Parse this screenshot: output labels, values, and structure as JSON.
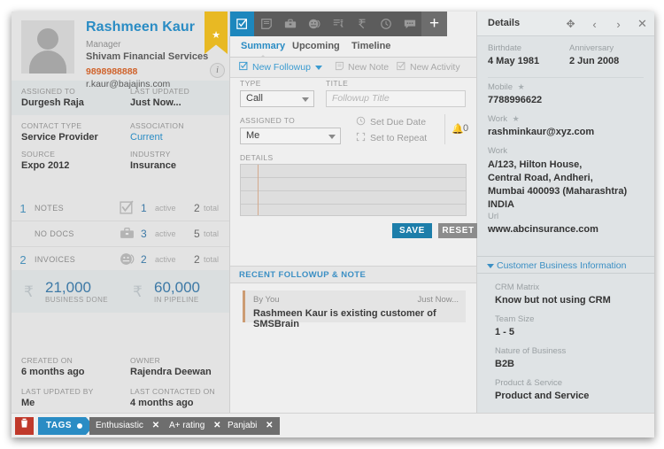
{
  "contact": {
    "name": "Rashmeen Kaur",
    "role": "Manager",
    "company": "Shivam Financial Services",
    "phone": "9898988888",
    "email": "r.kaur@bajajins.com",
    "info_icon": "info-icon",
    "star_icon": "star-icon",
    "fields": [
      {
        "label": "ASSIGNED TO",
        "value": "Durgesh Raja",
        "blue": false
      },
      {
        "label": "LAST UPDATED",
        "value": "Just Now...",
        "blue": false
      },
      {
        "label": "CONTACT TYPE",
        "value": "Service Provider",
        "blue": false
      },
      {
        "label": "ASSOCIATION",
        "value": "Current",
        "blue": true
      },
      {
        "label": "SOURCE",
        "value": "Expo 2012",
        "blue": false
      },
      {
        "label": "INDUSTRY",
        "value": "Insurance",
        "blue": false
      }
    ],
    "stats": [
      {
        "count": "1",
        "label": "NOTES",
        "icon": "checkbox-icon",
        "active": "1",
        "active_word": "active",
        "total": "2",
        "total_word": "total"
      },
      {
        "count": "",
        "label": "NO DOCS",
        "icon": "briefcase-icon",
        "active": "3",
        "active_word": "active",
        "total": "5",
        "total_word": "total"
      },
      {
        "count": "2",
        "label": "INVOICES",
        "icon": "invoice-coin-icon",
        "active": "2",
        "active_word": "active",
        "total": "2",
        "total_word": "total"
      }
    ],
    "money": [
      {
        "currency": "₹",
        "value": "21,000",
        "label": "BUSINESS DONE"
      },
      {
        "currency": "₹",
        "value": "60,000",
        "label": "IN PIPELINE"
      }
    ],
    "footer_fields": [
      {
        "label": "CREATED ON",
        "value": "6 months ago"
      },
      {
        "label": "OWNER",
        "value": "Rajendra Deewan"
      },
      {
        "label": "LAST UPDATED BY",
        "value": "Me"
      },
      {
        "label": "LAST CONTACTED ON",
        "value": "4 months ago"
      }
    ]
  },
  "tags_bar": {
    "delete_icon": "trash-icon",
    "tags_label": "TAGS",
    "tags": [
      "Enthusiastic",
      "A+ rating",
      "Panjabi"
    ],
    "remove_icon": "x-icon"
  },
  "toolbar": {
    "icons": [
      {
        "name": "task-checkbox-icon",
        "glyph": "☑",
        "active": true
      },
      {
        "name": "note-icon",
        "glyph": "▤",
        "active": false
      },
      {
        "name": "briefcase-icon",
        "glyph": "▬",
        "active": false
      },
      {
        "name": "invoice-coin-icon",
        "glyph": "◉",
        "active": false
      },
      {
        "name": "rupee-list-icon",
        "glyph": "▦",
        "active": false
      },
      {
        "name": "rupee-icon",
        "glyph": "₹",
        "active": false
      },
      {
        "name": "history-clock-icon",
        "glyph": "◷",
        "active": false
      },
      {
        "name": "chat-bubble-icon",
        "glyph": "▭",
        "active": false
      }
    ],
    "add_label": "+"
  },
  "window_controls": {
    "move_icon": "move-icon",
    "prev_icon": "chevron-left-icon",
    "next_icon": "chevron-right-icon",
    "close_icon": "close-icon"
  },
  "tabs": [
    {
      "label": "Summary",
      "active": true
    },
    {
      "label": "Upcoming",
      "active": false
    },
    {
      "label": "Timeline",
      "active": false
    }
  ],
  "actions": [
    {
      "label": "New Followup",
      "icon": "checkbox-icon",
      "enabled": true,
      "has_caret": true
    },
    {
      "label": "New Note",
      "icon": "note-icon",
      "enabled": false,
      "has_caret": false
    },
    {
      "label": "New Activity",
      "icon": "checkbox-icon",
      "enabled": false,
      "has_caret": false
    }
  ],
  "form": {
    "type_label": "TYPE",
    "type_value": "Call",
    "title_label": "TITLE",
    "title_placeholder": "Followup Title",
    "assigned_label": "ASSIGNED TO",
    "assigned_value": "Me",
    "set_due_date": "Set Due Date",
    "set_due_date_icon": "clock-icon",
    "set_to_repeat": "Set to Repeat",
    "set_to_repeat_icon": "repeat-icon",
    "reminder_icon": "bell-icon",
    "reminder_count": "0",
    "details_label": "DETAILS",
    "details_value": "",
    "save_label": "SAVE",
    "reset_label": "RESET"
  },
  "recent": {
    "heading": "RECENT FOLLOWUP & NOTE",
    "items": [
      {
        "author": "By You",
        "time": "Just Now...",
        "text": "Rashmeen Kaur is existing customer of SMSBrain"
      }
    ]
  },
  "details_panel": {
    "title": "Details",
    "rows": [
      {
        "label": "Birthdate",
        "value": "4 May 1981",
        "star": false
      },
      {
        "label": "Anniversary",
        "value": "2 Jun 2008",
        "star": false
      },
      {
        "label": "Mobile",
        "value": "7788996622",
        "star": true
      },
      {
        "label": "Work",
        "value": "rashminkaur@xyz.com",
        "star": true
      }
    ],
    "address_label": "Work",
    "address_lines": [
      "A/123, Hilton House,",
      "Central Road, Andheri,",
      "Mumbai 400093 (Maharashtra) INDIA"
    ],
    "url_label": "Url",
    "url_value": "www.abcinsurance.com",
    "business_section": {
      "title": "Customer Business Information",
      "rows": [
        {
          "label": "CRM Matrix",
          "value": "Know but not using CRM"
        },
        {
          "label": "Team Size",
          "value": "1 - 5"
        },
        {
          "label": "Nature of Business",
          "value": "B2B"
        },
        {
          "label": "Product & Service",
          "value": "Product and Service"
        }
      ]
    }
  },
  "colors": {
    "accent_blue": "#2a8cc4",
    "toolbar_dark": "#5c5c5c",
    "ribbon_yellow": "#e8b923",
    "phone_orange": "#d0622a",
    "save_blue": "#1d7eaa",
    "tag_gray": "#6e6e6e",
    "delete_red": "#c0392b"
  }
}
